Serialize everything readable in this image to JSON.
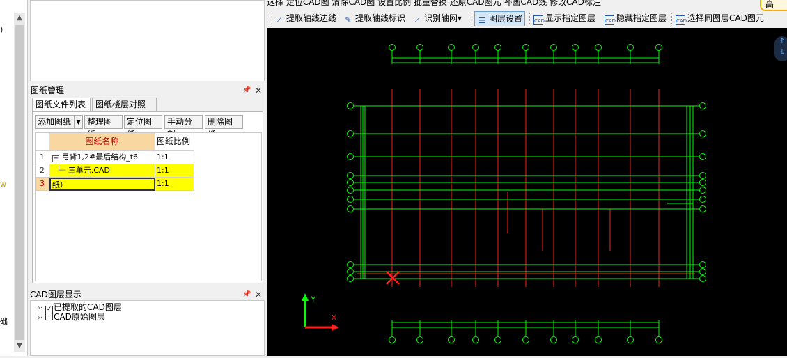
{
  "left_strip": {
    "frag_top": ")",
    "frag_mid": "w",
    "frag_bottom": "础"
  },
  "drawing_panel": {
    "title": "图纸管理",
    "tabs": [
      "图纸文件列表",
      "图纸楼层对照表"
    ],
    "buttons": {
      "add": "添加图纸",
      "add_dropdown": "▾",
      "organize": "整理图纸",
      "locate": "定位图纸",
      "split": "手动分割",
      "delete": "删除图纸"
    },
    "columns": {
      "name": "图纸名称",
      "scale": "图纸比例"
    },
    "rows": [
      {
        "num": "1",
        "expander": "−",
        "name": "弓背1,2#最后结构_t6",
        "scale": "1:1"
      },
      {
        "num": "2",
        "name": "三单元.CADI",
        "scale": "1:1"
      },
      {
        "num": "3",
        "name": "纸）",
        "scale": "1:1"
      }
    ]
  },
  "layer_panel": {
    "title": "CAD图层显示",
    "items": [
      {
        "checked": true,
        "label": "已提取的CAD图层"
      },
      {
        "checked": false,
        "label": "CAD原始图层"
      }
    ]
  },
  "toolbar": {
    "top_row_cut": "选择    定位CAD图   清除CAD图   设置比例   批量替换   还原CAD图元   补画CAD线   修改CAD标注",
    "user_button": "高",
    "extract_axis_edge": "提取轴线边线",
    "extract_axis_label": "提取轴线标识",
    "identify_grid": "识别轴网",
    "identify_grid_dropdown": "▾",
    "layer_settings": "图层设置",
    "show_layer": "显示指定图层",
    "hide_layer": "隐藏指定图层",
    "select_same_layer": "选择同图层CAD图元",
    "cad_badge": "CAD"
  },
  "canvas": {
    "background": "#000000",
    "grid_color": "#00ff00",
    "axis_color": "#ff0000",
    "axis_x_label": "X",
    "axis_y_label": "Y"
  }
}
